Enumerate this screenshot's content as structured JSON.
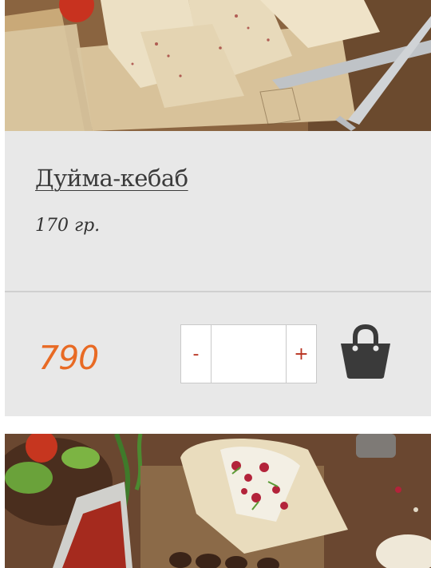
{
  "product": {
    "title": "Дуйма-кебаб",
    "weight": "170 гр.",
    "price": "790",
    "image_top_alt": "",
    "image_bottom_alt": ""
  },
  "quantity": {
    "minus_label": "-",
    "plus_label": "+",
    "value": ""
  },
  "cart": {
    "icon": "shopping-bag-icon"
  },
  "colors": {
    "card_background": "#e8e8e8",
    "price": "#e86a24",
    "qty_sign": "#b8321f",
    "cart_icon": "#3a3a3a"
  }
}
